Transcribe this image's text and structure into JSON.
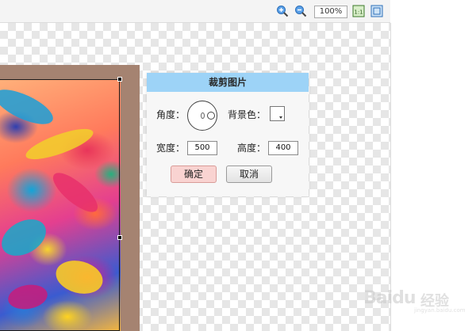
{
  "toolbar": {
    "zoom_in_icon": "zoom-in-icon",
    "zoom_out_icon": "zoom-out-icon",
    "zoom_value": "100%",
    "actual_size_icon": "actual-size-icon",
    "fit_screen_icon": "fit-screen-icon",
    "actual_size_glyph": "1:1"
  },
  "crop_panel": {
    "title": "裁剪图片",
    "angle_label": "角度：",
    "background_label": "背景色：",
    "width_label": "宽度：",
    "width_value": "500",
    "height_label": "高度：",
    "height_value": "400",
    "ok_label": "确定",
    "cancel_label": "取消",
    "background_color": "#ffffff"
  },
  "watermark": {
    "brand": "Baidu",
    "cn": "经验",
    "url": "jingyan.baidu.com"
  },
  "colors": {
    "panel_header": "#9dd3f7",
    "ok_button": "#f9d3d1",
    "image_border": "#a58371"
  }
}
